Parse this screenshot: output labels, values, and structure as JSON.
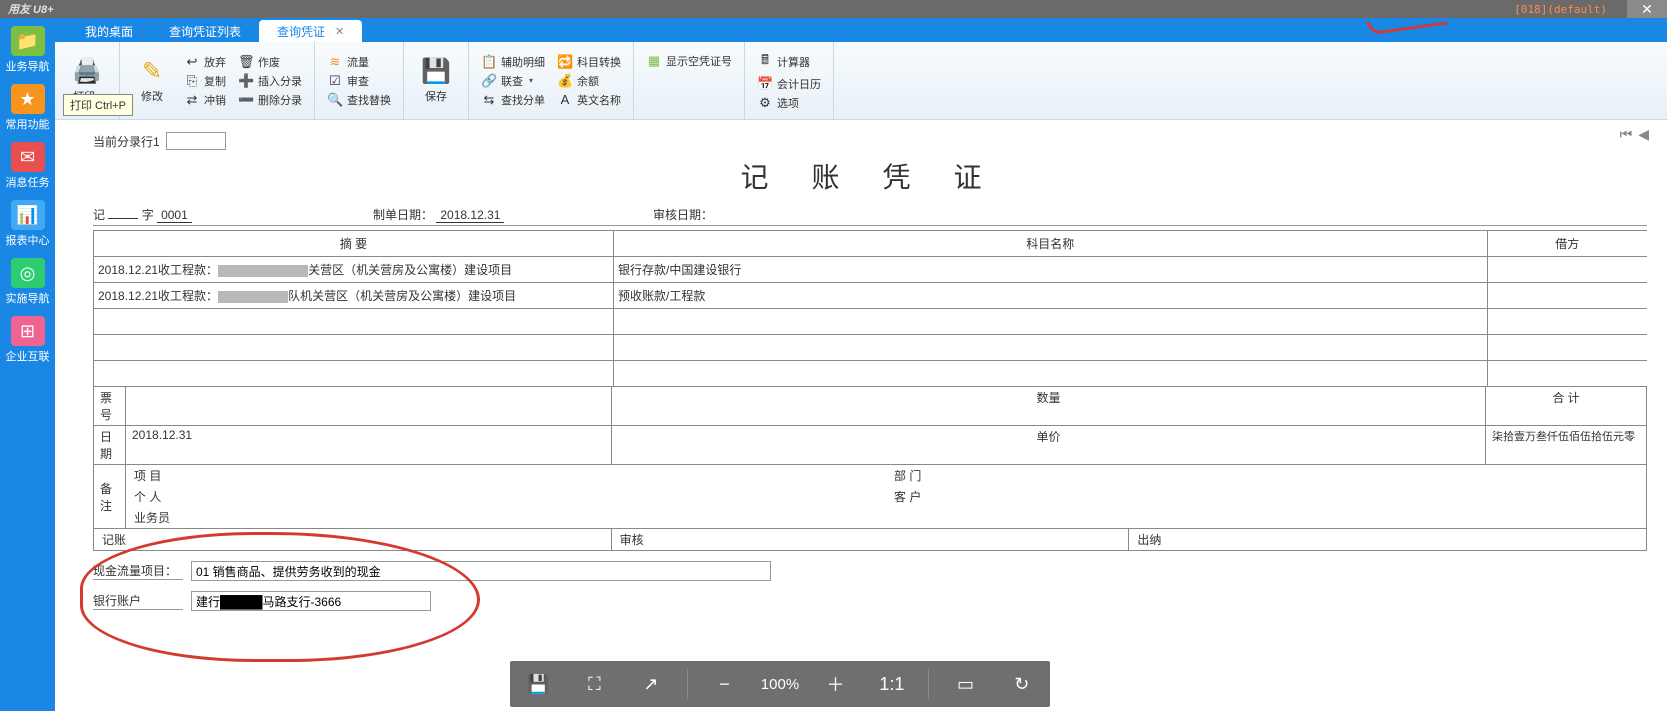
{
  "titlebar": {
    "app": "用友 U8+",
    "info": "[018](default)"
  },
  "tabs": [
    {
      "label": "我的桌面",
      "active": false
    },
    {
      "label": "查询凭证列表",
      "active": false
    },
    {
      "label": "查询凭证",
      "active": true
    }
  ],
  "ribbon": {
    "print": "打印",
    "print_tooltip": "打印 Ctrl+P",
    "edit": "修改",
    "abandon": "放弃",
    "copy": "复制",
    "reverse": "冲销",
    "obsolete": "作废",
    "insert": "插入分录",
    "delete": "删除分录",
    "flow": "流量",
    "review": "审查",
    "findreplace": "查找替换",
    "save": "保存",
    "auxdetail": "辅助明细",
    "linkquery": "联查",
    "findsplit": "查找分单",
    "subjconv": "科目转换",
    "balance": "余额",
    "engname": "英文名称",
    "showempty": "显示空凭证号",
    "calc": "计算器",
    "acccal": "会计日历",
    "options": "选项"
  },
  "content": {
    "entry_label": "当前分录行1",
    "title": "记 账 凭 证",
    "voucher_prefix": "记",
    "voucher_zi": "字",
    "voucher_no": "0001",
    "make_date_label": "制单日期：",
    "make_date": "2018.12.31",
    "audit_date_label": "审核日期：",
    "audit_date": "",
    "th_summary": "摘 要",
    "th_subject": "科目名称",
    "th_debit": "借方",
    "rows": [
      {
        "summary_pre": "2018.12.21收工程款：",
        "summary_post": "关营区（机关营房及公寓楼）建设项目",
        "subject": "银行存款/中国建设银行"
      },
      {
        "summary_pre": "2018.12.21收工程款：",
        "summary_post": "队机关营区（机关营房及公寓楼）建设项目",
        "subject": "预收账款/工程款"
      }
    ],
    "ticket_label": "票号",
    "date_label": "日期",
    "date_val": "2018.12.31",
    "qty_label": "数量",
    "price_label": "单价",
    "total_label": "合 计",
    "total_cn": "柒拾壹万叁仟伍佰伍拾伍元零",
    "remark_label": "备注",
    "project_label": "项 目",
    "person_label": "个 人",
    "salesman_label": "业务员",
    "dept_label": "部 门",
    "cust_label": "客 户",
    "sig_book": "记账",
    "sig_audit": "审核",
    "sig_cashier": "出纳",
    "cashflow_label": "现金流量项目：",
    "cashflow_val": "01 销售商品、提供劳务收到的现金",
    "bank_label": "银行账户",
    "bank_val": "建行█████马路支行-3666"
  },
  "bottombar": {
    "zoom": "100%"
  }
}
